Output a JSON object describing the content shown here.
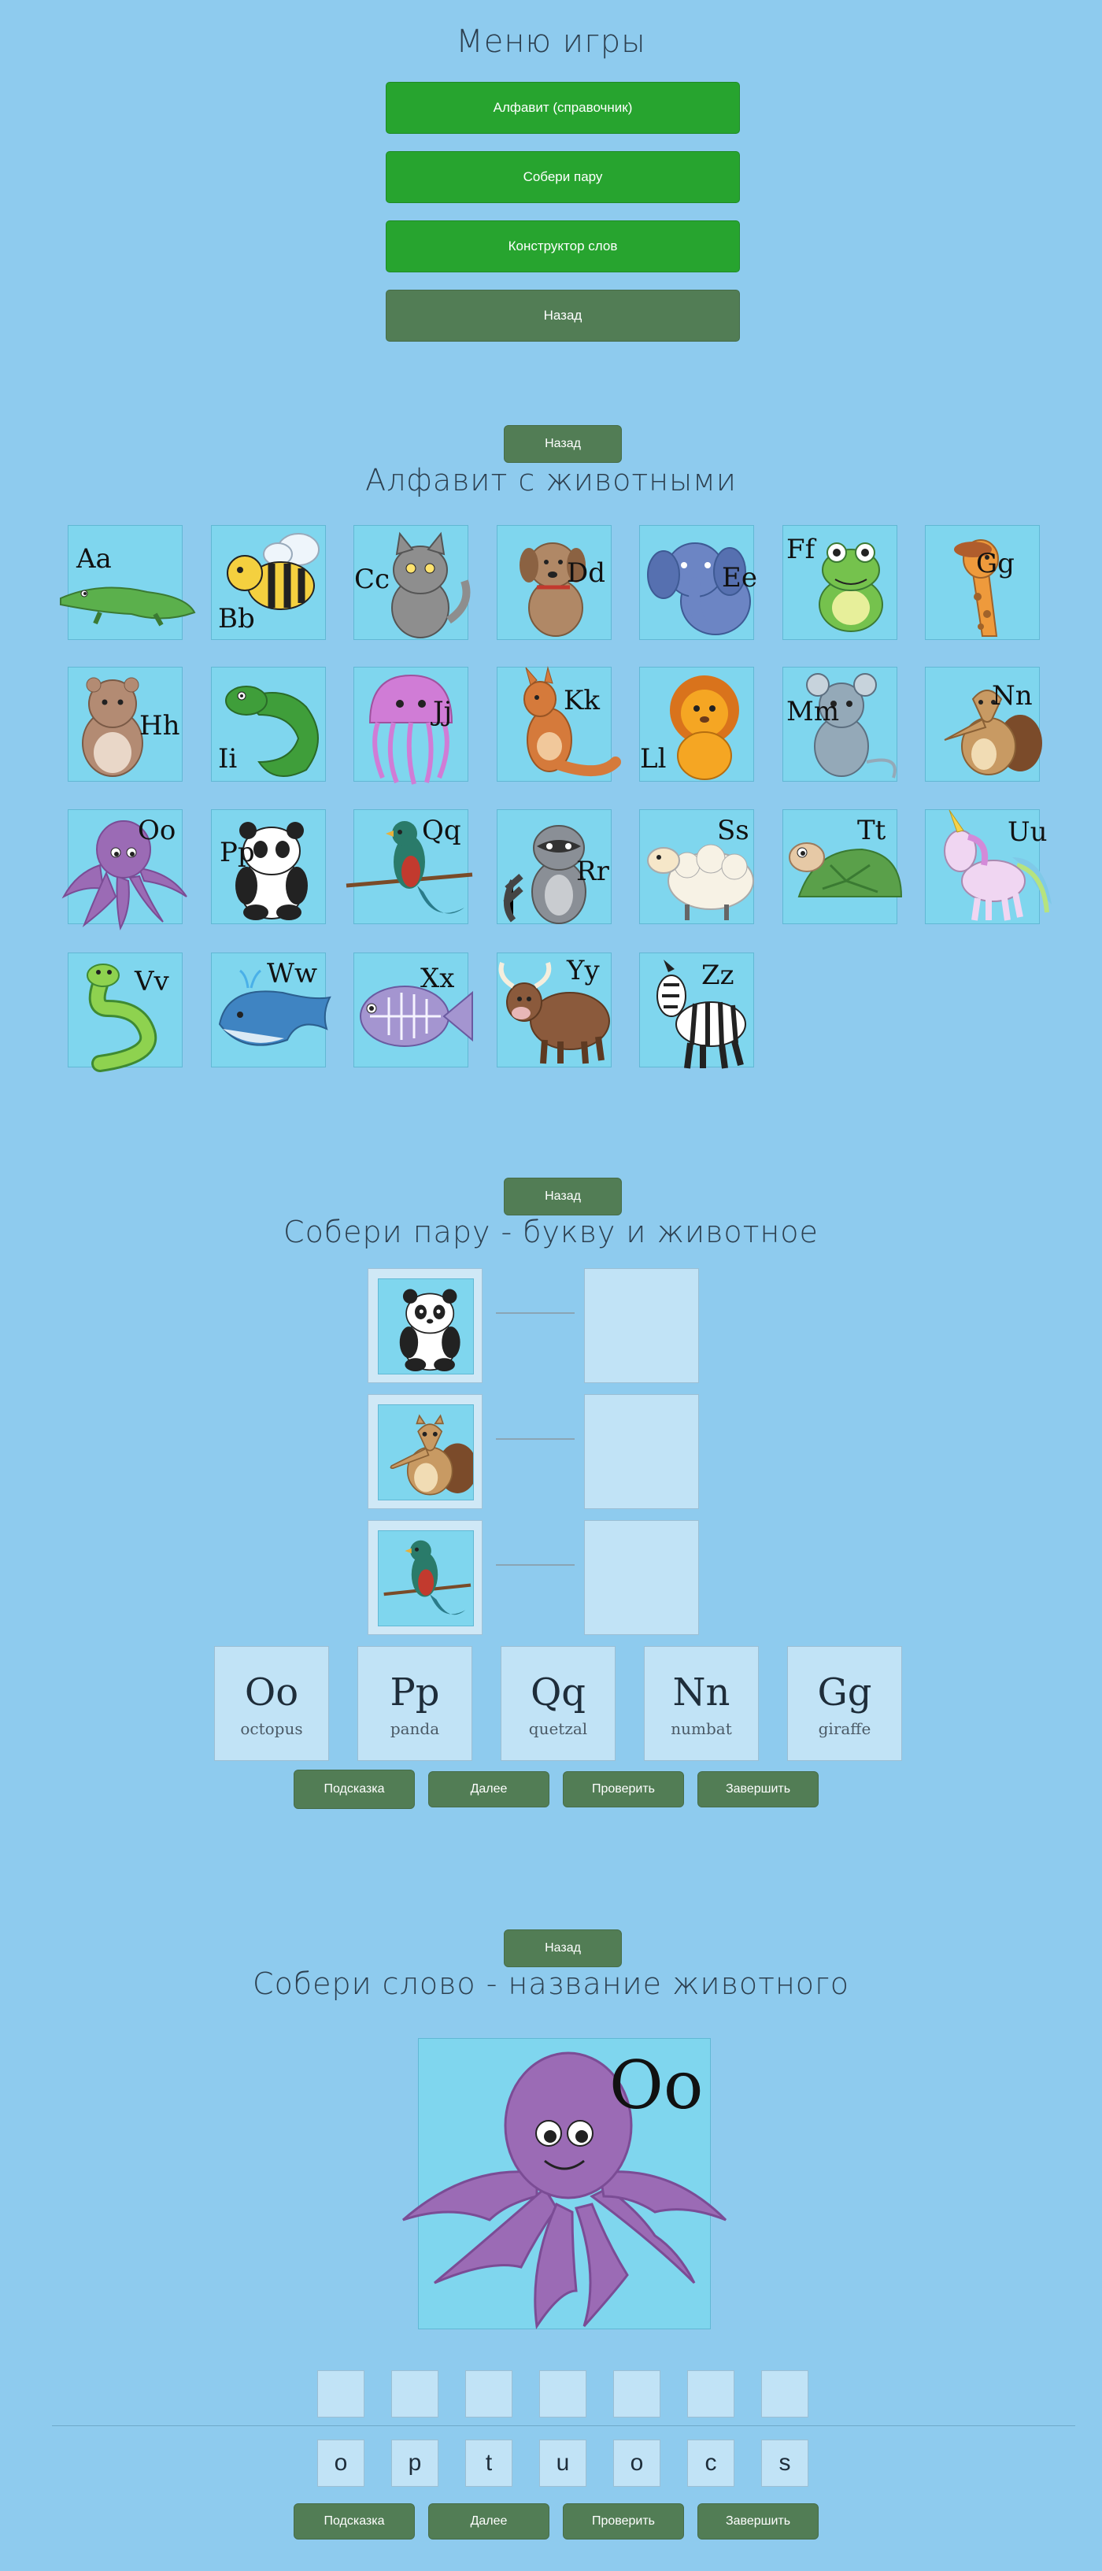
{
  "menu": {
    "title": "Меню игры",
    "buttons": [
      "Алфавит (справочник)",
      "Собери пару",
      "Конструктор слов",
      "Назад"
    ]
  },
  "alphabet": {
    "back": "Назад",
    "title": "Алфавит с животными",
    "tiles": [
      {
        "letters": "Aa",
        "animal": "crocodile-icon",
        "color": "#5bb04c"
      },
      {
        "letters": "Bb",
        "animal": "bee-icon",
        "color": "#f4d03f"
      },
      {
        "letters": "Cc",
        "animal": "cat-icon",
        "color": "#8e8e8e"
      },
      {
        "letters": "Dd",
        "animal": "dog-icon",
        "color": "#b08866"
      },
      {
        "letters": "Ee",
        "animal": "elephant-icon",
        "color": "#6c85c4"
      },
      {
        "letters": "Ff",
        "animal": "frog-icon",
        "color": "#75c24d"
      },
      {
        "letters": "Gg",
        "animal": "giraffe-icon",
        "color": "#ee9a3c"
      },
      {
        "letters": "Hh",
        "animal": "hamster-icon",
        "color": "#b38b73"
      },
      {
        "letters": "Ii",
        "animal": "iguana-icon",
        "color": "#3f9e3a"
      },
      {
        "letters": "Jj",
        "animal": "jellyfish-icon",
        "color": "#d07cd6"
      },
      {
        "letters": "Kk",
        "animal": "kangaroo-icon",
        "color": "#d57a3b"
      },
      {
        "letters": "Ll",
        "animal": "lion-icon",
        "color": "#f5a623"
      },
      {
        "letters": "Mm",
        "animal": "mouse-icon",
        "color": "#94a9b8"
      },
      {
        "letters": "Nn",
        "animal": "numbat-icon",
        "color": "#c89a63"
      },
      {
        "letters": "Oo",
        "animal": "octopus-icon",
        "color": "#9b6bb5"
      },
      {
        "letters": "Pp",
        "animal": "panda-icon",
        "color": "#222222"
      },
      {
        "letters": "Qq",
        "animal": "quetzal-icon",
        "color": "#2a7b6a"
      },
      {
        "letters": "Rr",
        "animal": "raccoon-icon",
        "color": "#8a8f96"
      },
      {
        "letters": "Ss",
        "animal": "sheep-icon",
        "color": "#f7f2e5"
      },
      {
        "letters": "Tt",
        "animal": "turtle-icon",
        "color": "#5aa04a"
      },
      {
        "letters": "Uu",
        "animal": "unicorn-icon",
        "color": "#f0d6f2"
      },
      {
        "letters": "Vv",
        "animal": "snake-icon",
        "color": "#8ed24f"
      },
      {
        "letters": "Ww",
        "animal": "whale-icon",
        "color": "#3f84c2"
      },
      {
        "letters": "Xx",
        "animal": "xray-fish-icon",
        "color": "#a495d0"
      },
      {
        "letters": "Yy",
        "animal": "yak-icon",
        "color": "#8b5a3c"
      },
      {
        "letters": "Zz",
        "animal": "zebra-icon",
        "color": "#222222"
      }
    ]
  },
  "pairs": {
    "back": "Назад",
    "title": "Собери пару - букву и животное",
    "animals": [
      "panda-icon",
      "numbat-icon",
      "quetzal-icon"
    ],
    "cards": [
      {
        "letters": "Oo",
        "word": "octopus"
      },
      {
        "letters": "Pp",
        "word": "panda"
      },
      {
        "letters": "Qq",
        "word": "quetzal"
      },
      {
        "letters": "Nn",
        "word": "numbat"
      },
      {
        "letters": "Gg",
        "word": "giraffe"
      }
    ],
    "buttons": [
      "Подсказка",
      "Далее",
      "Проверить",
      "Завершить"
    ]
  },
  "words": {
    "back": "Назад",
    "title": "Собери слово - название животного",
    "picture": {
      "letters": "Oo",
      "animal": "octopus-icon",
      "color": "#9b6bb5"
    },
    "letters": [
      "o",
      "p",
      "t",
      "u",
      "o",
      "c",
      "s"
    ],
    "buttons": [
      "Подсказка",
      "Далее",
      "Проверить",
      "Завершить"
    ]
  }
}
